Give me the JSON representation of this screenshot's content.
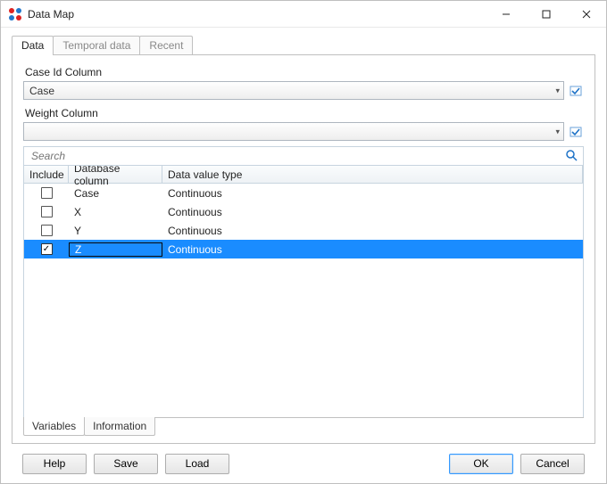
{
  "window": {
    "title": "Data Map"
  },
  "top_tabs": [
    "Data",
    "Temporal data",
    "Recent"
  ],
  "top_tab_active": 0,
  "fields": {
    "case_label": "Case Id Column",
    "case_value": "Case",
    "weight_label": "Weight Column",
    "weight_value": ""
  },
  "search": {
    "placeholder": "Search"
  },
  "grid": {
    "headers": {
      "include": "Include",
      "db": "Database column",
      "type": "Data value type"
    },
    "rows": [
      {
        "include": false,
        "db": "Case",
        "type": "Continuous",
        "selected": false
      },
      {
        "include": false,
        "db": "X",
        "type": "Continuous",
        "selected": false
      },
      {
        "include": false,
        "db": "Y",
        "type": "Continuous",
        "selected": false
      },
      {
        "include": true,
        "db": "Z",
        "type": "Continuous",
        "selected": true
      }
    ]
  },
  "sub_tabs": [
    "Variables",
    "Information"
  ],
  "sub_tab_active": 0,
  "footer": {
    "help": "Help",
    "save": "Save",
    "load": "Load",
    "ok": "OK",
    "cancel": "Cancel"
  }
}
